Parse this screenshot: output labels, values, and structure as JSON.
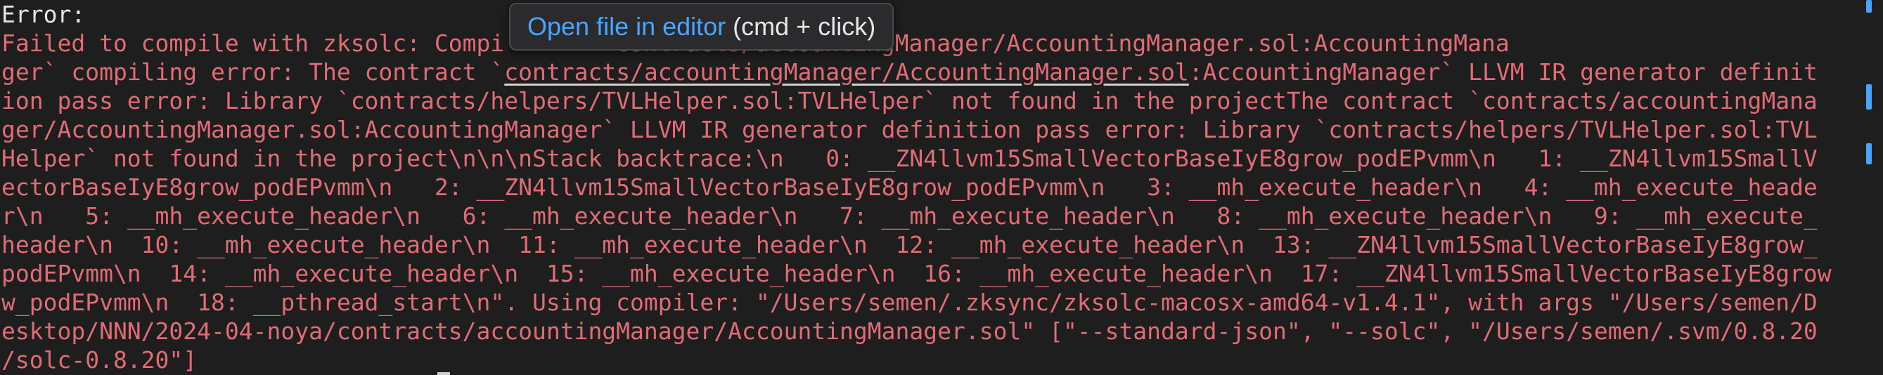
{
  "terminal": {
    "error_label": "Error:",
    "lines": [
      {
        "prefix": "Failed to compile with zksolc: Compi",
        "suffix": "contracts/accountingManager/AccountingManager.sol:AccountingMana"
      },
      {
        "before": "ger` compiling error: The contract `",
        "link": "contracts/accountingManager/AccountingManager.sol",
        "after": ":AccountingManager` LLVM IR generator definit"
      },
      {
        "text": "ion pass error: Library `contracts/helpers/TVLHelper.sol:TVLHelper` not found in the projectThe contract `contracts/accountingMana"
      },
      {
        "text": "ger/AccountingManager.sol:AccountingManager` LLVM IR generator definition pass error: Library `contracts/helpers/TVLHelper.sol:TVL"
      },
      {
        "text": "Helper` not found in the project\\n\\n\\nStack backtrace:\\n   0: __ZN4llvm15SmallVectorBaseIyE8grow_podEPvmm\\n   1: __ZN4llvm15SmallV"
      },
      {
        "text": "ectorBaseIyE8grow_podEPvmm\\n   2: __ZN4llvm15SmallVectorBaseIyE8grow_podEPvmm\\n   3: __mh_execute_header\\n   4: __mh_execute_heade"
      },
      {
        "text": "r\\n   5: __mh_execute_header\\n   6: __mh_execute_header\\n   7: __mh_execute_header\\n   8: __mh_execute_header\\n   9: __mh_execute_"
      },
      {
        "text": "header\\n  10: __mh_execute_header\\n  11: __mh_execute_header\\n  12: __mh_execute_header\\n  13: __ZN4llvm15SmallVectorBaseIyE8grow_"
      },
      {
        "text": "podEPvmm\\n  14: __mh_execute_header\\n  15: __mh_execute_header\\n  16: __mh_execute_header\\n  17: __ZN4llvm15SmallVectorBaseIyE8grow"
      },
      {
        "text": "w_podEPvmm\\n  18: __pthread_start\\n\". Using compiler: \"/Users/semen/.zksync/zksolc-macosx-amd64-v1.4.1\", with args \"/Users/semen/D"
      },
      {
        "text": "esktop/NNN/2024-04-noya/contracts/accountingManager/AccountingManager.sol\" [\"--standard-json\", \"--solc\", \"/Users/semen/.svm/0.8.20"
      },
      {
        "text": "/solc-0.8.20\"]"
      }
    ]
  },
  "tooltip": {
    "action": "Open file in editor",
    "hint": " (cmd + click)"
  },
  "colors": {
    "background": "#1e1e1e",
    "error_text": "#e06c75",
    "label_text": "#e6e6e6",
    "tooltip_link": "#4aa3ff",
    "scroll_marker": "#4aa3ff"
  }
}
